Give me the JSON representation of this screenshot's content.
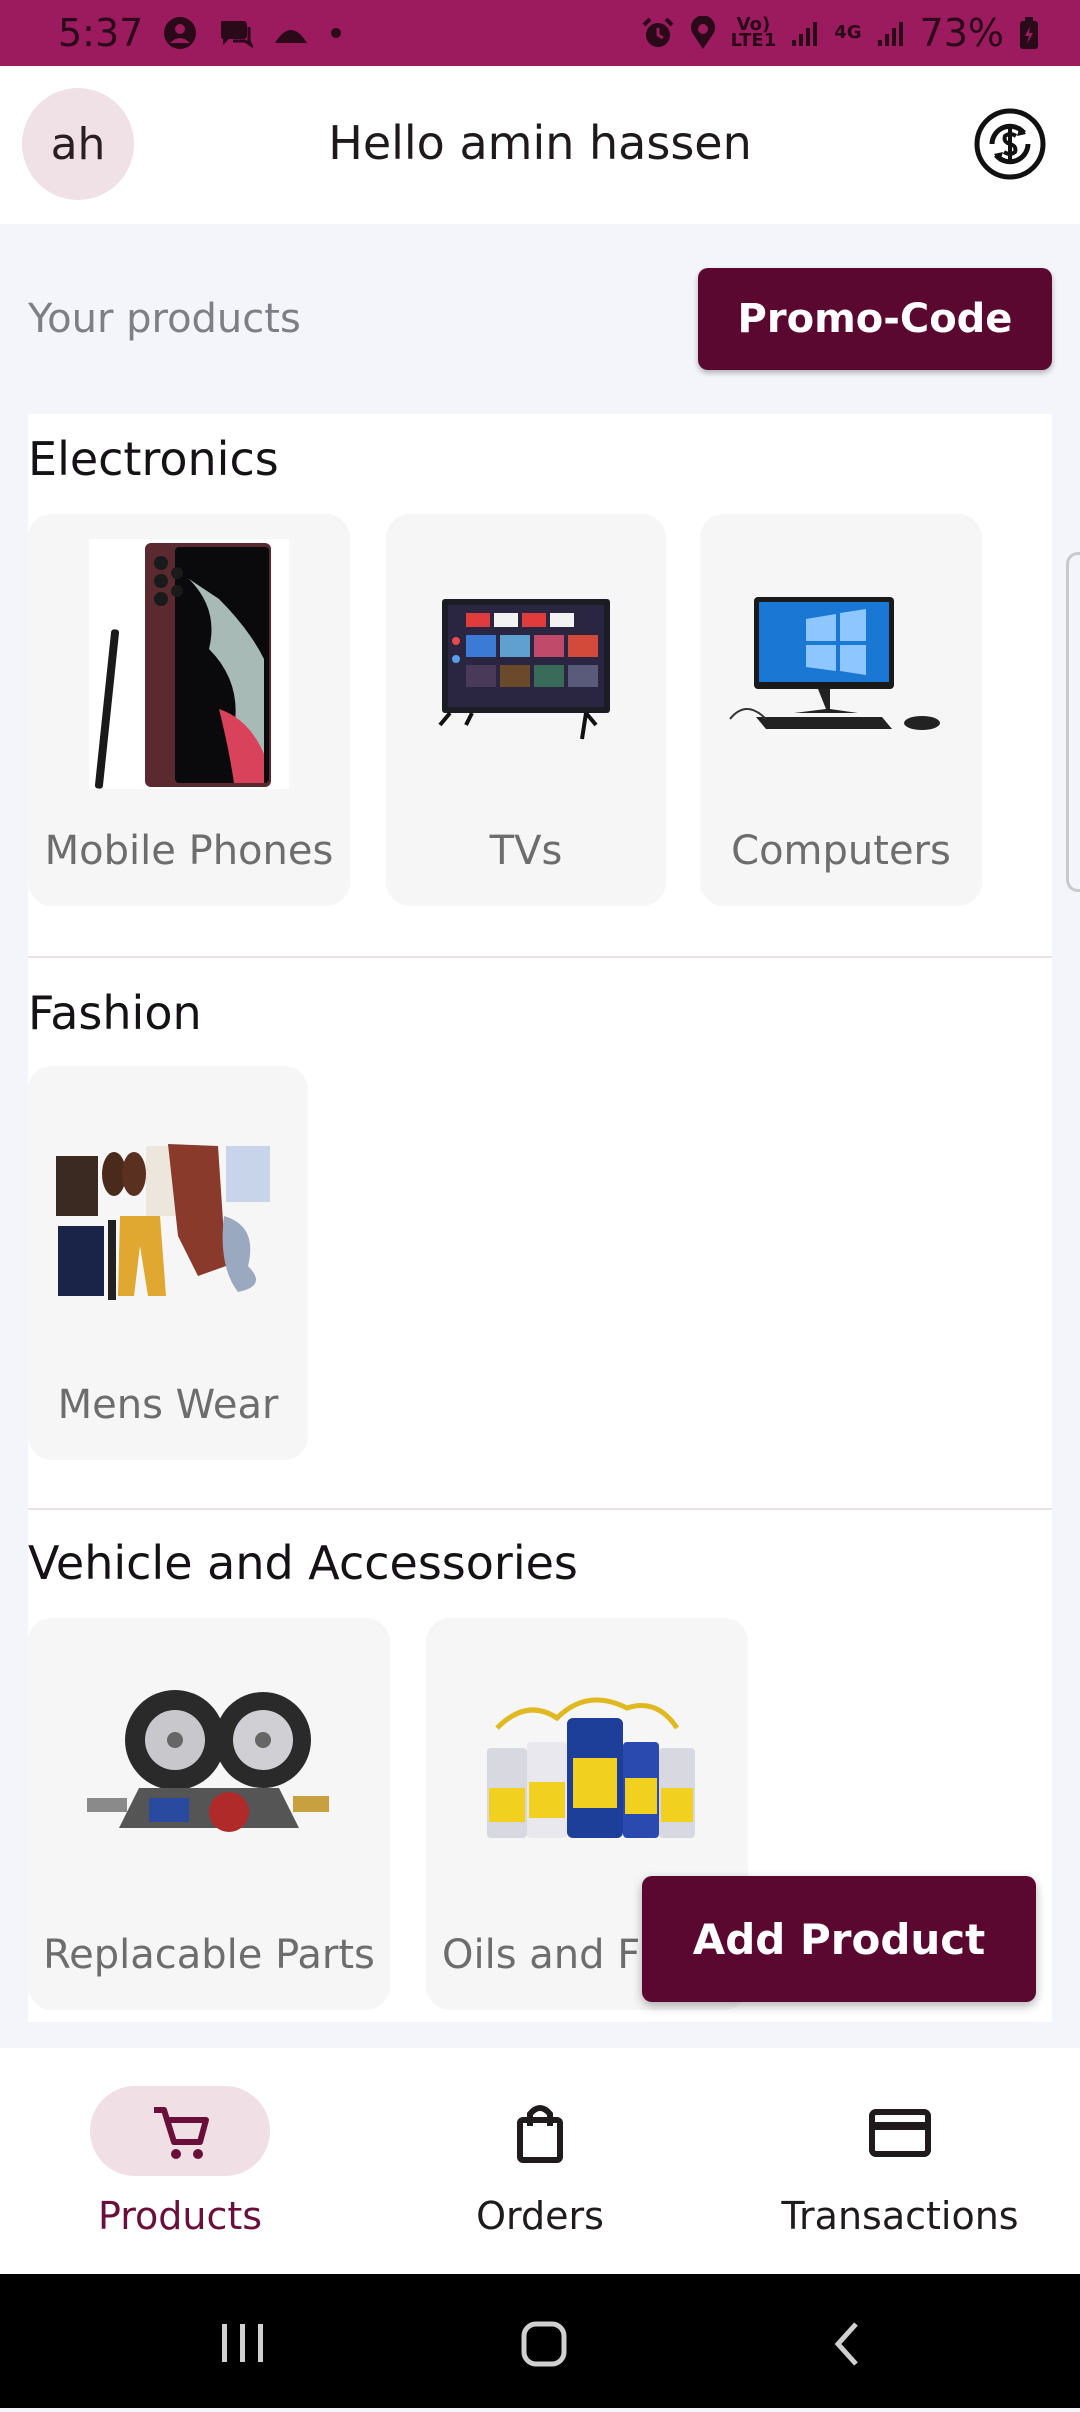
{
  "status_bar": {
    "time": "5:37",
    "network_label": "Vo)\nLTE1",
    "signal_label": "4G",
    "battery": "73%"
  },
  "header": {
    "avatar_initials": "ah",
    "greeting": "Hello amin hassen"
  },
  "products_bar": {
    "title": "Your products",
    "promo_button": "Promo-Code"
  },
  "sections": [
    {
      "title": "Electronics",
      "items": [
        {
          "label": "Mobile Phones",
          "icon": "smartphone-image"
        },
        {
          "label": "TVs",
          "icon": "tv-image"
        },
        {
          "label": "Computers",
          "icon": "desktop-computer-image"
        }
      ]
    },
    {
      "title": "Fashion",
      "items": [
        {
          "label": "Mens Wear",
          "icon": "mens-clothing-image"
        }
      ]
    },
    {
      "title": "Vehicle and Accessories",
      "items": [
        {
          "label": "Replacable Parts",
          "icon": "car-parts-image"
        },
        {
          "label": "Oils and Fl",
          "icon": "motor-oil-image"
        }
      ]
    }
  ],
  "add_product_button": "Add Product",
  "bottom_nav": [
    {
      "label": "Products",
      "icon": "cart-icon",
      "active": true
    },
    {
      "label": "Orders",
      "icon": "shopping-bag-icon",
      "active": false
    },
    {
      "label": "Transactions",
      "icon": "credit-card-icon",
      "active": false
    }
  ],
  "colors": {
    "status_bar": "#9c1a5e",
    "primary": "#5b0830",
    "active_pill": "#f0dfe4"
  }
}
